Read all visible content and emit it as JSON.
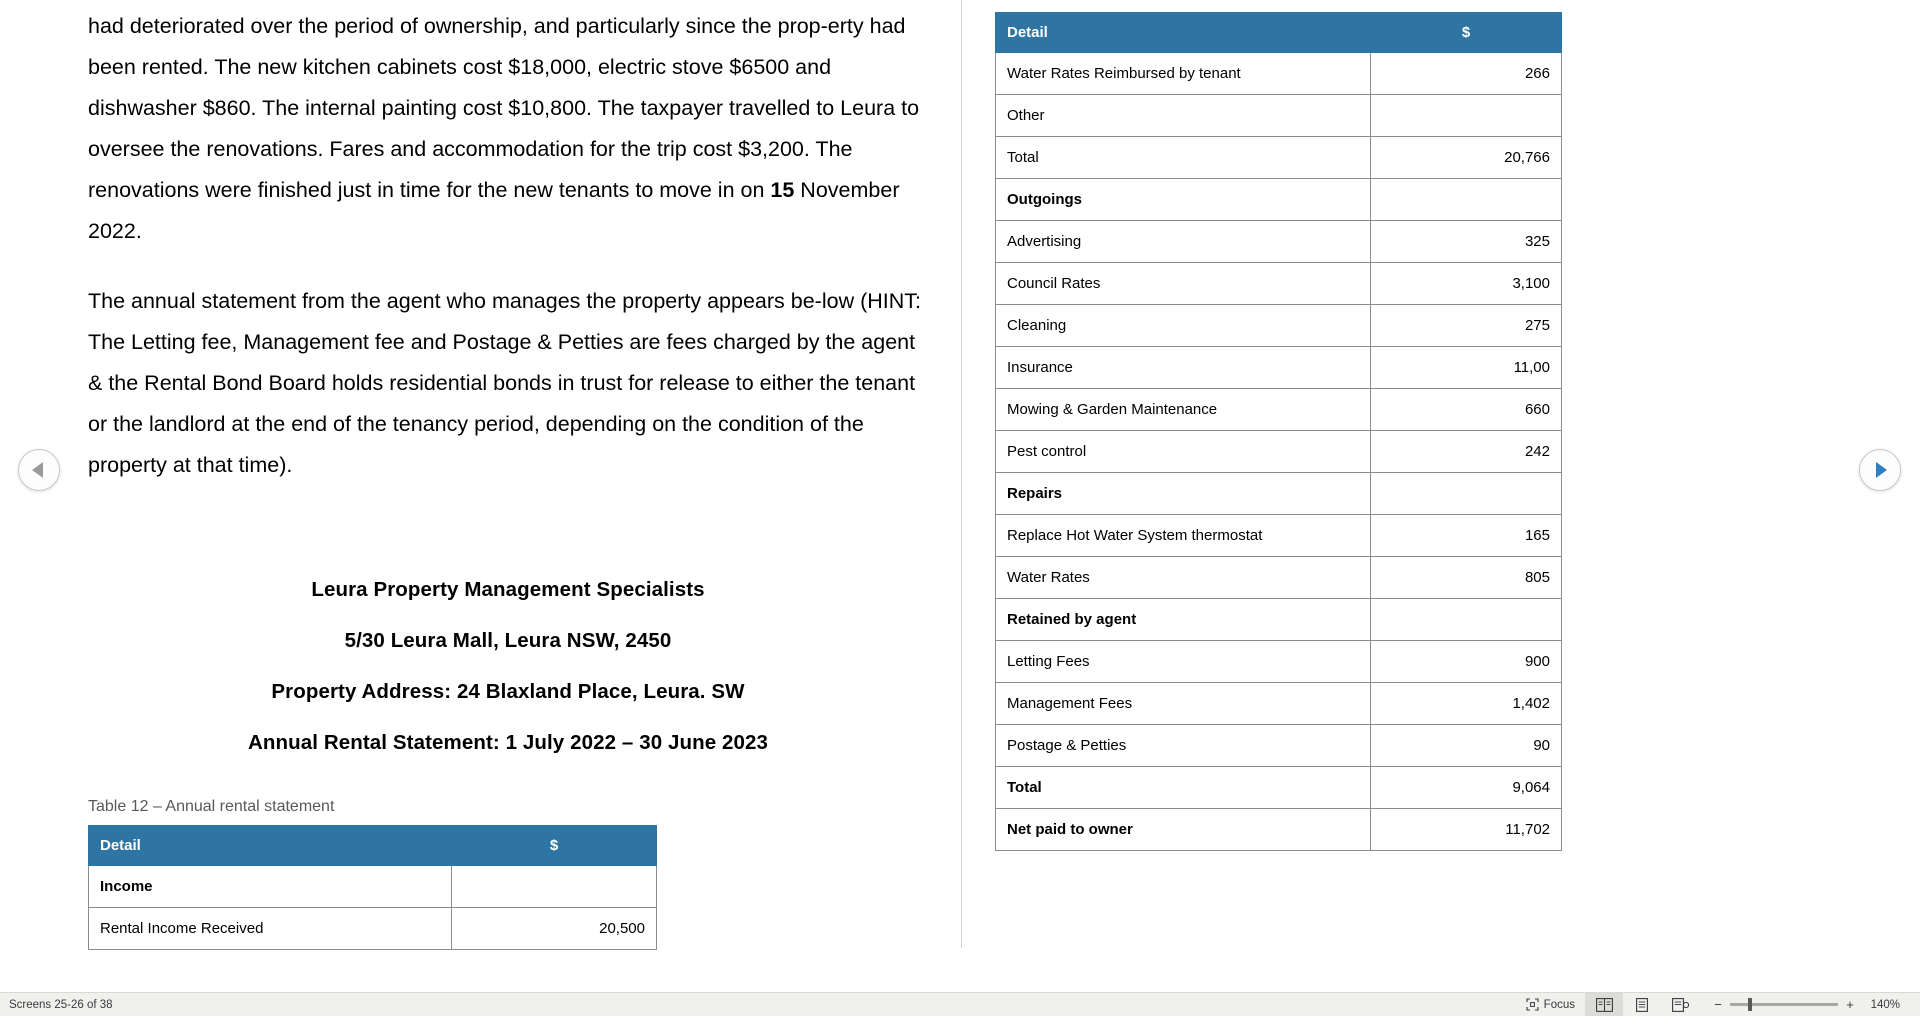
{
  "document": {
    "paragraphs": [
      "had deteriorated over the period of ownership, and particularly since the prop-erty had been rented.  The new kitchen cabinets cost $18,000, electric stove $6500 and dishwasher $860.  The internal painting cost $10,800. The taxpayer travelled to Leura to oversee the renovations.  Fares and accommodation for the trip cost $3,200.  The renovations were finished just in time for the new tenants to move in on ",
      "The annual statement from the agent who manages the property appears be-low (HINT: The Letting fee, Management fee and Postage & Petties are fees charged by the agent & the Rental Bond Board holds residential bonds in trust for release to either the tenant or the landlord at the end of the tenancy period, depending on the condition of the property at that time)."
    ],
    "paragraph1_bold": "15",
    "paragraph1_tail": " November 2022.",
    "headings": [
      "Leura Property Management Specialists",
      "5/30 Leura Mall, Leura NSW, 2450",
      "Property Address: 24 Blaxland Place, Leura. SW",
      "Annual Rental Statement: 1 July 2022 – 30 June 2023"
    ],
    "table_caption": "Table 12 – Annual rental statement",
    "table_header": {
      "detail": "Detail",
      "amount": "$"
    },
    "table_left_rows": [
      {
        "label": "Income",
        "amount": "",
        "style": "group"
      },
      {
        "label": "Rental Income Received",
        "amount": "20,500",
        "style": "item"
      }
    ],
    "table_right_rows": [
      {
        "label": "Water Rates Reimbursed by tenant",
        "amount": "266",
        "style": "item"
      },
      {
        "label": "Other",
        "amount": "",
        "style": "item"
      },
      {
        "label": "Total",
        "amount": "20,766",
        "style": "item"
      },
      {
        "label": "Outgoings",
        "amount": "",
        "style": "group"
      },
      {
        "label": "Advertising",
        "amount": "325",
        "style": "item"
      },
      {
        "label": "Council Rates",
        "amount": "3,100",
        "style": "item"
      },
      {
        "label": "Cleaning",
        "amount": "275",
        "style": "item"
      },
      {
        "label": "Insurance",
        "amount": "11,00",
        "style": "item"
      },
      {
        "label": "Mowing & Garden Maintenance",
        "amount": "660",
        "style": "item"
      },
      {
        "label": "Pest control",
        "amount": "242",
        "style": "item"
      },
      {
        "label": "Repairs",
        "amount": "",
        "style": "group"
      },
      {
        "label": "Replace Hot Water System thermostat",
        "amount": "165",
        "style": "item"
      },
      {
        "label": "Water Rates",
        "amount": "805",
        "style": "item"
      },
      {
        "label": "Retained by agent",
        "amount": "",
        "style": "group"
      },
      {
        "label": "Letting Fees",
        "amount": "900",
        "style": "item"
      },
      {
        "label": "Management Fees",
        "amount": "1,402",
        "style": "item"
      },
      {
        "label": "Postage & Petties",
        "amount": "90",
        "style": "item"
      },
      {
        "label": "Total",
        "amount": "9,064",
        "style": "group"
      },
      {
        "label": "Net paid to owner",
        "amount": "11,702",
        "style": "group"
      }
    ]
  },
  "navigation": {
    "previous_label": "Previous screen",
    "next_label": "Next screen"
  },
  "statusbar": {
    "screens_label": "Screens 25-26 of 38",
    "focus_label": "Focus",
    "zoom_level": "140%",
    "zoom_out": "−",
    "zoom_in": "+",
    "view_two_page": "two-page-view",
    "view_one_page": "one-page-view",
    "view_web": "web-layout-view"
  },
  "colors": {
    "table_header_bg": "#2e75a3",
    "table_border": "#8c8c8c",
    "caption_text": "#595959",
    "statusbar_bg": "#f0f0ee"
  }
}
